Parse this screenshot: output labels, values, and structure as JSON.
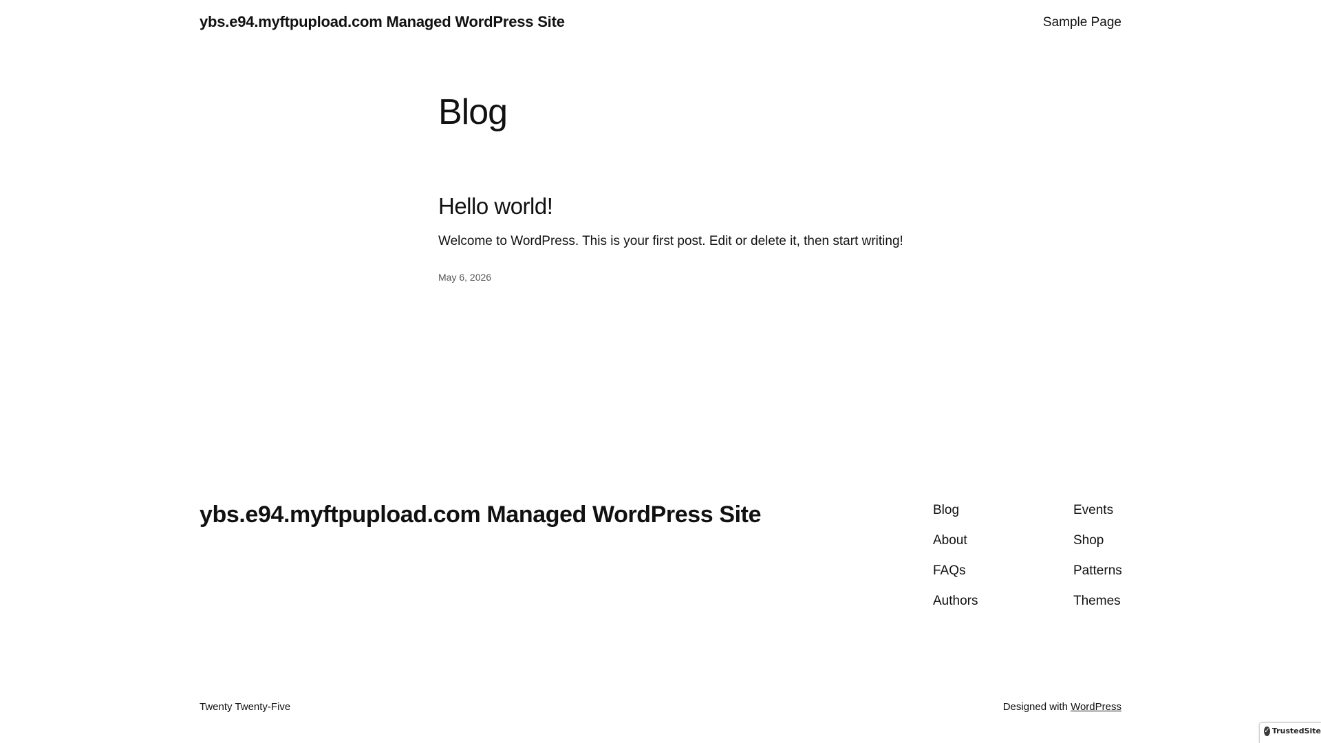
{
  "header": {
    "site_title": "ybs.e94.myftpupload.com Managed WordPress Site",
    "nav": [
      "Sample Page"
    ]
  },
  "main": {
    "heading": "Blog",
    "posts": [
      {
        "title": "Hello world!",
        "excerpt": "Welcome to WordPress. This is your first post. Edit or delete it, then start writing!",
        "date": "May 6, 2026"
      }
    ]
  },
  "footer": {
    "site_title": "ybs.e94.myftpupload.com Managed WordPress Site",
    "nav_col_1": [
      "Blog",
      "About",
      "FAQs",
      "Authors"
    ],
    "nav_col_2": [
      "Events",
      "Shop",
      "Patterns",
      "Themes"
    ],
    "theme_name": "Twenty Twenty-Five",
    "credit_prefix": "Designed with",
    "credit_link": "WordPress"
  },
  "badge": {
    "icon": "check-icon",
    "text": "TrustedSite"
  }
}
